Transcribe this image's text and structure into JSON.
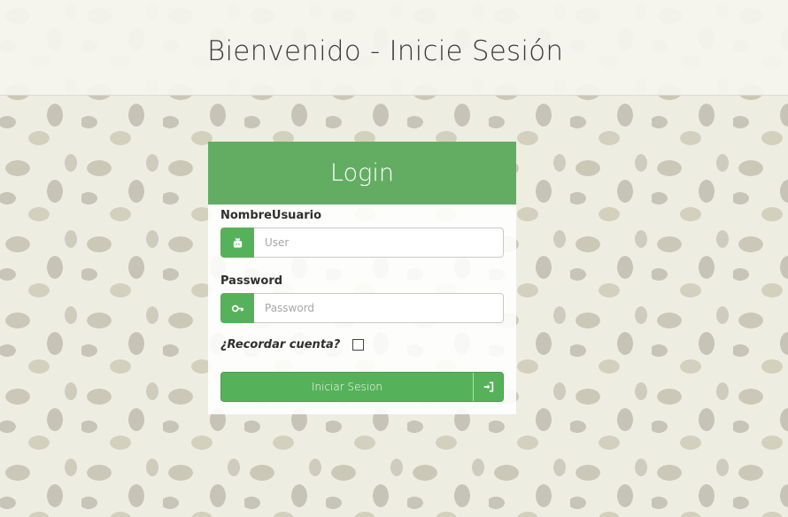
{
  "header": {
    "title": "Bienvenido - Inicie Sesión"
  },
  "panel": {
    "title": "Login",
    "username": {
      "label": "NombreUsuario",
      "placeholder": "User",
      "icon": "user-icon"
    },
    "password": {
      "label": "Password",
      "placeholder": "Password",
      "icon": "key-icon"
    },
    "remember": {
      "label": "¿Recordar cuenta?",
      "checked": false
    },
    "submit": {
      "label": "Iniciar Sesion",
      "icon": "sign-in-icon"
    }
  },
  "colors": {
    "accent": "#63ad63",
    "button": "#56b25a",
    "background": "#eeede2"
  }
}
